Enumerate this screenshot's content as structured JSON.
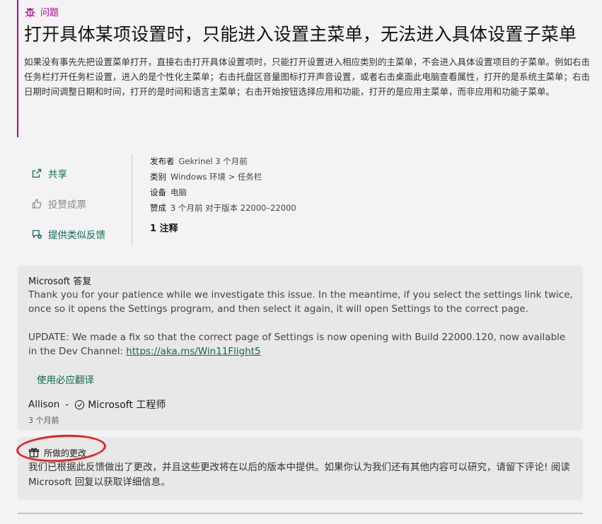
{
  "issue": {
    "type_label": "问题",
    "title": "打开具体某项设置时，只能进入设置主菜单，无法进入具体设置子菜单",
    "description": "如果没有事先先把设置菜单打开，直接右击打开具体设置项时，只能打开设置进入相应类别的主菜单，不会进入具体设置项目的子菜单。例如右击任务栏打开任务栏设置，进入的是个性化主菜单；右击托盘区音量图标打开声音设置，或者右击桌面此电脑查看属性，打开的是系统主菜单；右击日期时间调整日期和时间，打开的是时间和语言主菜单；右击开始按钮选择应用和功能，打开的是应用主菜单，而非应用和功能子菜单。"
  },
  "actions": {
    "share": "共享",
    "upvote": "投赞成票",
    "feedback": "提供类似反馈"
  },
  "meta": {
    "publisher_key": "发布者",
    "publisher_val": "Gekrinel 3 个月前",
    "category_key": "类别",
    "category_val": "Windows 环境 > 任务栏",
    "device_key": "设备",
    "device_val": "电脑",
    "upvote_key": "赞成",
    "upvote_val": "3 个月前 对于版本 22000–22000",
    "comments": "1 注释"
  },
  "reply": {
    "title": "Microsoft 答复",
    "paragraph1": "Thank you for your patience while we investigate this issue. In the meantime, if you select the settings link twice, once so it opens the Settings program, and then select it again, it will open Settings to the correct page.",
    "paragraph2_text": "UPDATE: We made a fix so that the correct page of Settings is now opening with Build 22000.120, now available in the Dev Channel: ",
    "paragraph2_link": "https://aka.ms/Win11Flight5",
    "translate": "使用必应翻译",
    "author_name": "Allison",
    "author_dash": "-",
    "author_role": "Microsoft 工程师",
    "time": "3 个月前"
  },
  "changes": {
    "title": "所做的更改",
    "body": "我们已根据此反馈做出了更改，并且这些更改将在以后的版本中提供。如果你认为我们还有其他内容可以研究，请留下评论! 阅读 Microsoft 回复以获取详细信息。"
  },
  "colors": {
    "accent_issue": "#b4009e",
    "accent_link": "#0e6b54",
    "annotation_circle": "#e32424"
  }
}
